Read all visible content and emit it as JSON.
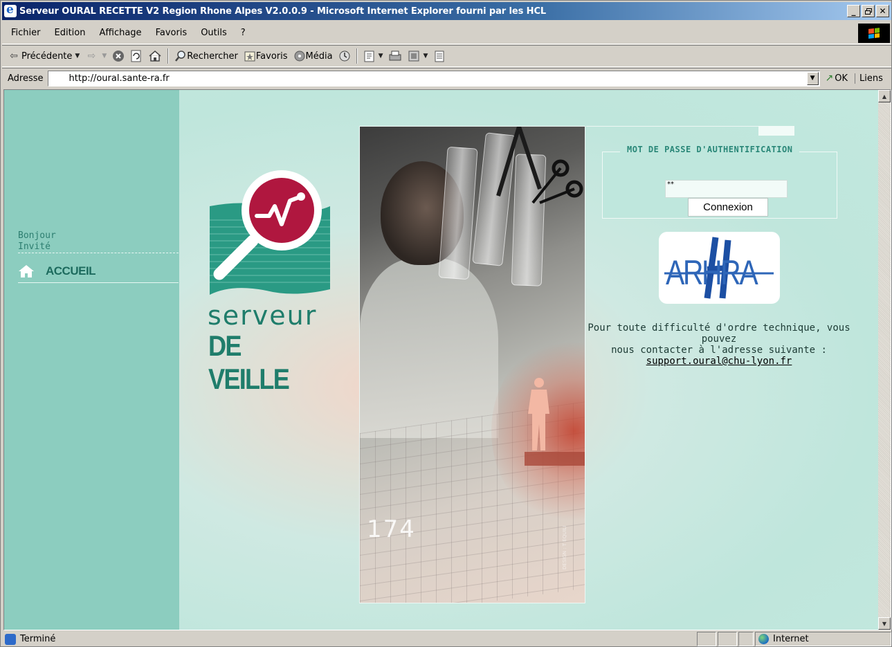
{
  "window": {
    "title": "Serveur OURAL RECETTE V2 Region Rhone Alpes V2.0.0.9 - Microsoft Internet Explorer fourni par les HCL",
    "controls": {
      "minimize": "_",
      "maximize": "&#9645;",
      "close": "X"
    }
  },
  "menubar": {
    "items": [
      "Fichier",
      "Edition",
      "Affichage",
      "Favoris",
      "Outils",
      "?"
    ]
  },
  "toolbar": {
    "back_label": "Précédente",
    "search_label": "Rechercher",
    "favorites_label": "Favoris",
    "media_label": "Média"
  },
  "addressbar": {
    "label": "Adresse",
    "url": "http://oural.sante-ra.fr",
    "go_label": "OK",
    "links_label": "Liens"
  },
  "sidebar": {
    "greeting_line1": "Bonjour",
    "greeting_line2": "Invité",
    "nav_home": "ACCUEIL"
  },
  "logo": {
    "line1": "serveur",
    "line2": "DE VEILLE"
  },
  "photo": {
    "number": "174",
    "credit": "DESIGN : T EQUILI"
  },
  "login": {
    "legend": "MOT DE PASSE D'AUTHENTIFICATION",
    "password_value": "**",
    "button_label": "Connexion"
  },
  "partner": {
    "logo_text": "ARHRA"
  },
  "support": {
    "line1": "Pour toute difficulté d'ordre technique, vous pouvez",
    "line2": "nous contacter à l'adresse suivante :",
    "email": "support.oural@chu-lyon.fr"
  },
  "statusbar": {
    "status_text": "Terminé",
    "zone_label": "Internet"
  },
  "colors": {
    "sidebar_bg": "#8ccdbf",
    "content_bg": "#c6ebe3",
    "brand_green": "#1f7d6b",
    "logo_red": "#b0173f",
    "arhra_blue": "#2e66b8",
    "titlebar_blue": "#0a246a"
  }
}
